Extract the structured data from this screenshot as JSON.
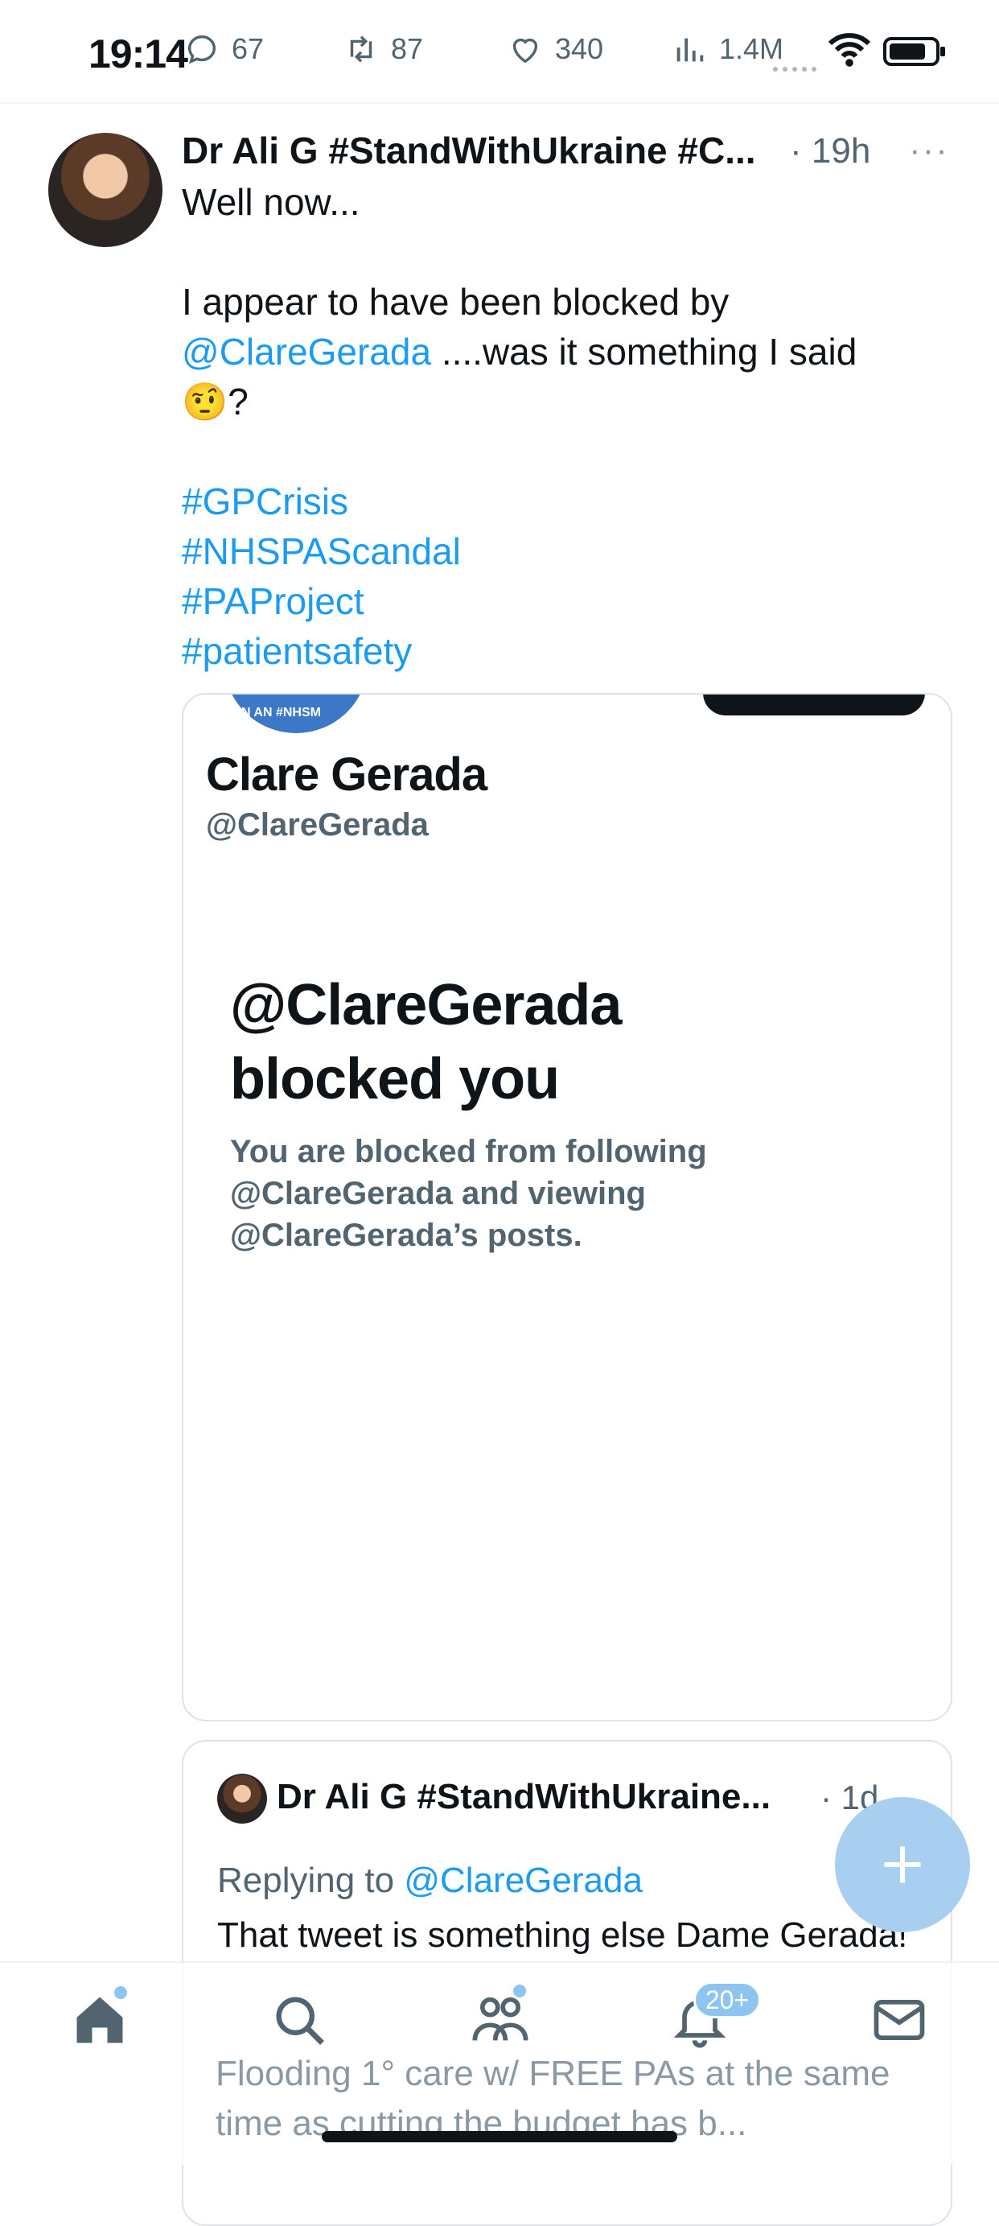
{
  "status_bar": {
    "time": "19:14",
    "icons": [
      "wifi-icon",
      "battery-icon"
    ]
  },
  "previous_tweet_stats": {
    "replies": "67",
    "retweets": "87",
    "likes": "340",
    "views": "1.4M"
  },
  "tweet": {
    "author_name": "Dr Ali G #StandWithUkraine #C...",
    "time": "· 19h",
    "more": "···",
    "line1": "Well now...",
    "line2": "I appear to have been blocked by",
    "mention": "@ClareGerada",
    "line3_rest": " ....was it something I said",
    "emoji": "🤨",
    "line4_rest": "?",
    "hashtags": [
      "#GPCrisis",
      "#NHSPAScandal",
      "#PAProject",
      "#patientsafety"
    ]
  },
  "embedded_image": {
    "avatar_text": "N AN #NHSM",
    "name": "Clare Gerada",
    "handle": "@ClareGerada",
    "title_line1": "@ClareGerada",
    "title_line2": "blocked you",
    "desc_line1": "You are blocked from following",
    "desc_line2": "@ClareGerada and viewing",
    "desc_line3": "@ClareGerada’s posts."
  },
  "quoted_reply": {
    "author_name": "Dr Ali G #StandWithUkraine...",
    "time": "· 1d",
    "replying_label": "Replying to ",
    "replying_to": "@ClareGerada",
    "text": "That tweet is something else Dame Gerada!",
    "text2": "Flooding 1° care w/ FREE PAs at the same time as cutting the budget has b..."
  },
  "bottom_nav": {
    "items": [
      "home-icon",
      "search-icon",
      "communities-icon",
      "notifications-icon",
      "messages-icon"
    ],
    "notifications_badge": "20+"
  },
  "colors": {
    "accent": "#1d9bf0",
    "fab": "#a8cfef",
    "secondary_text": "#536471"
  }
}
